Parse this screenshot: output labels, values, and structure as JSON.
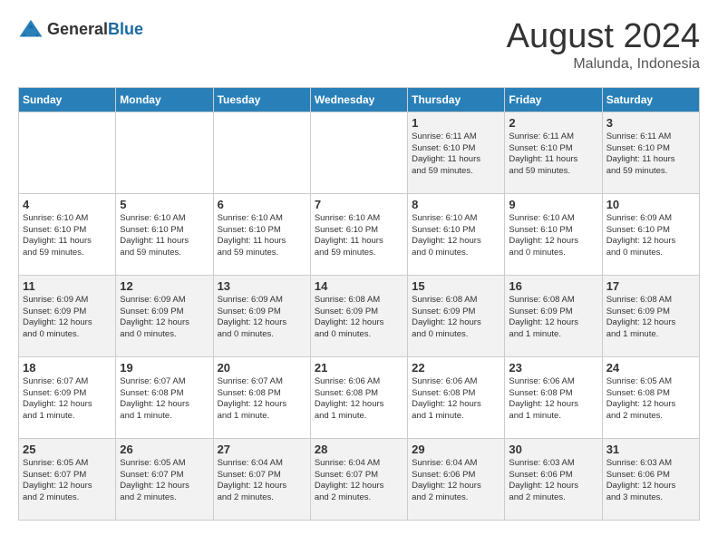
{
  "logo": {
    "general": "General",
    "blue": "Blue"
  },
  "title": "August 2024",
  "subtitle": "Malunda, Indonesia",
  "headers": [
    "Sunday",
    "Monday",
    "Tuesday",
    "Wednesday",
    "Thursday",
    "Friday",
    "Saturday"
  ],
  "weeks": [
    [
      {
        "day": "",
        "info": ""
      },
      {
        "day": "",
        "info": ""
      },
      {
        "day": "",
        "info": ""
      },
      {
        "day": "",
        "info": ""
      },
      {
        "day": "1",
        "info": "Sunrise: 6:11 AM\nSunset: 6:10 PM\nDaylight: 11 hours\nand 59 minutes."
      },
      {
        "day": "2",
        "info": "Sunrise: 6:11 AM\nSunset: 6:10 PM\nDaylight: 11 hours\nand 59 minutes."
      },
      {
        "day": "3",
        "info": "Sunrise: 6:11 AM\nSunset: 6:10 PM\nDaylight: 11 hours\nand 59 minutes."
      }
    ],
    [
      {
        "day": "4",
        "info": "Sunrise: 6:10 AM\nSunset: 6:10 PM\nDaylight: 11 hours\nand 59 minutes."
      },
      {
        "day": "5",
        "info": "Sunrise: 6:10 AM\nSunset: 6:10 PM\nDaylight: 11 hours\nand 59 minutes."
      },
      {
        "day": "6",
        "info": "Sunrise: 6:10 AM\nSunset: 6:10 PM\nDaylight: 11 hours\nand 59 minutes."
      },
      {
        "day": "7",
        "info": "Sunrise: 6:10 AM\nSunset: 6:10 PM\nDaylight: 11 hours\nand 59 minutes."
      },
      {
        "day": "8",
        "info": "Sunrise: 6:10 AM\nSunset: 6:10 PM\nDaylight: 12 hours\nand 0 minutes."
      },
      {
        "day": "9",
        "info": "Sunrise: 6:10 AM\nSunset: 6:10 PM\nDaylight: 12 hours\nand 0 minutes."
      },
      {
        "day": "10",
        "info": "Sunrise: 6:09 AM\nSunset: 6:10 PM\nDaylight: 12 hours\nand 0 minutes."
      }
    ],
    [
      {
        "day": "11",
        "info": "Sunrise: 6:09 AM\nSunset: 6:09 PM\nDaylight: 12 hours\nand 0 minutes."
      },
      {
        "day": "12",
        "info": "Sunrise: 6:09 AM\nSunset: 6:09 PM\nDaylight: 12 hours\nand 0 minutes."
      },
      {
        "day": "13",
        "info": "Sunrise: 6:09 AM\nSunset: 6:09 PM\nDaylight: 12 hours\nand 0 minutes."
      },
      {
        "day": "14",
        "info": "Sunrise: 6:08 AM\nSunset: 6:09 PM\nDaylight: 12 hours\nand 0 minutes."
      },
      {
        "day": "15",
        "info": "Sunrise: 6:08 AM\nSunset: 6:09 PM\nDaylight: 12 hours\nand 0 minutes."
      },
      {
        "day": "16",
        "info": "Sunrise: 6:08 AM\nSunset: 6:09 PM\nDaylight: 12 hours\nand 1 minute."
      },
      {
        "day": "17",
        "info": "Sunrise: 6:08 AM\nSunset: 6:09 PM\nDaylight: 12 hours\nand 1 minute."
      }
    ],
    [
      {
        "day": "18",
        "info": "Sunrise: 6:07 AM\nSunset: 6:09 PM\nDaylight: 12 hours\nand 1 minute."
      },
      {
        "day": "19",
        "info": "Sunrise: 6:07 AM\nSunset: 6:08 PM\nDaylight: 12 hours\nand 1 minute."
      },
      {
        "day": "20",
        "info": "Sunrise: 6:07 AM\nSunset: 6:08 PM\nDaylight: 12 hours\nand 1 minute."
      },
      {
        "day": "21",
        "info": "Sunrise: 6:06 AM\nSunset: 6:08 PM\nDaylight: 12 hours\nand 1 minute."
      },
      {
        "day": "22",
        "info": "Sunrise: 6:06 AM\nSunset: 6:08 PM\nDaylight: 12 hours\nand 1 minute."
      },
      {
        "day": "23",
        "info": "Sunrise: 6:06 AM\nSunset: 6:08 PM\nDaylight: 12 hours\nand 1 minute."
      },
      {
        "day": "24",
        "info": "Sunrise: 6:05 AM\nSunset: 6:08 PM\nDaylight: 12 hours\nand 2 minutes."
      }
    ],
    [
      {
        "day": "25",
        "info": "Sunrise: 6:05 AM\nSunset: 6:07 PM\nDaylight: 12 hours\nand 2 minutes."
      },
      {
        "day": "26",
        "info": "Sunrise: 6:05 AM\nSunset: 6:07 PM\nDaylight: 12 hours\nand 2 minutes."
      },
      {
        "day": "27",
        "info": "Sunrise: 6:04 AM\nSunset: 6:07 PM\nDaylight: 12 hours\nand 2 minutes."
      },
      {
        "day": "28",
        "info": "Sunrise: 6:04 AM\nSunset: 6:07 PM\nDaylight: 12 hours\nand 2 minutes."
      },
      {
        "day": "29",
        "info": "Sunrise: 6:04 AM\nSunset: 6:06 PM\nDaylight: 12 hours\nand 2 minutes."
      },
      {
        "day": "30",
        "info": "Sunrise: 6:03 AM\nSunset: 6:06 PM\nDaylight: 12 hours\nand 2 minutes."
      },
      {
        "day": "31",
        "info": "Sunrise: 6:03 AM\nSunset: 6:06 PM\nDaylight: 12 hours\nand 3 minutes."
      }
    ]
  ]
}
